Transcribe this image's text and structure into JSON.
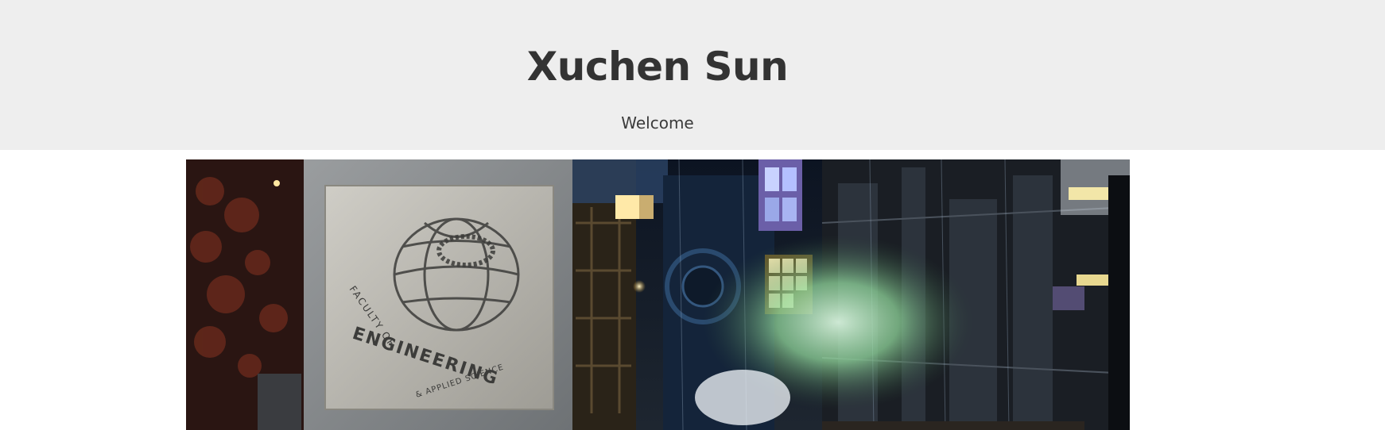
{
  "header": {
    "title": "Xuchen Sun",
    "subtitle": "Welcome"
  },
  "banner": {
    "sign_line_top": "FACULTY OF",
    "sign_line_main": "ENGINEERING",
    "sign_line_bottom": "& APPLIED SCIENCE"
  },
  "colors": {
    "header_bg": "#eeeeee",
    "title_text": "#333333"
  }
}
